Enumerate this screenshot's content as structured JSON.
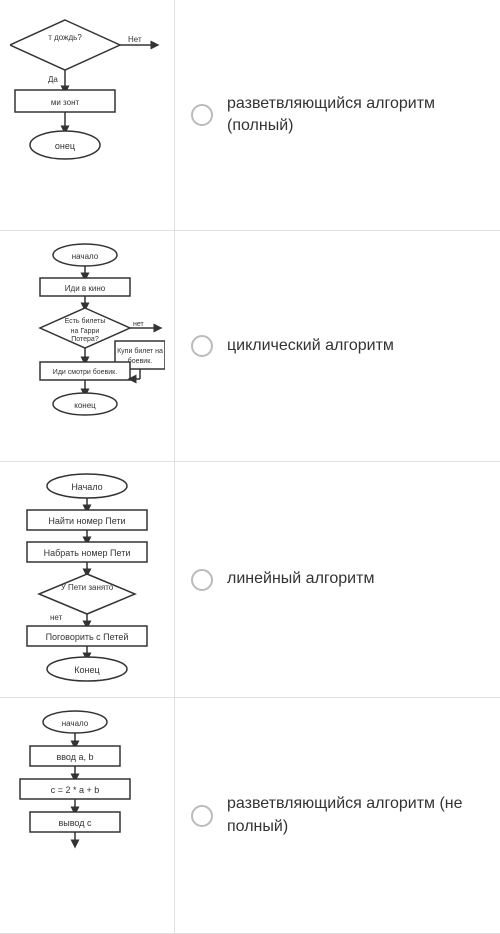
{
  "rows": [
    {
      "id": "row1",
      "answer_label": "разветвляющийся алгоритм (полный)",
      "chart_type": "branching_full"
    },
    {
      "id": "row2",
      "answer_label": "циклический алгоритм",
      "chart_type": "cyclic"
    },
    {
      "id": "row3",
      "answer_label": "линейный алгоритм",
      "chart_type": "linear"
    },
    {
      "id": "row4",
      "answer_label": "разветвляющийся алгоритм (не полный)",
      "chart_type": "branching_partial"
    }
  ]
}
